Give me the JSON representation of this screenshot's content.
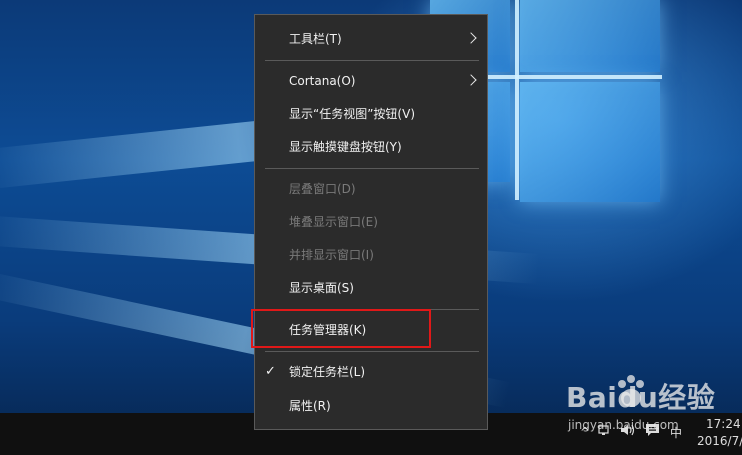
{
  "menu": {
    "items": [
      {
        "label": "工具栏(T)",
        "submenu": true,
        "enabled": true
      },
      {
        "label": "Cortana(O)",
        "submenu": true,
        "enabled": true
      },
      {
        "label": "显示“任务视图”按钮(V)",
        "enabled": true
      },
      {
        "label": "显示触摸键盘按钮(Y)",
        "enabled": true
      },
      {
        "label": "层叠窗口(D)",
        "enabled": false
      },
      {
        "label": "堆叠显示窗口(E)",
        "enabled": false
      },
      {
        "label": "并排显示窗口(I)",
        "enabled": false
      },
      {
        "label": "显示桌面(S)",
        "enabled": true
      },
      {
        "label": "任务管理器(K)",
        "enabled": true,
        "highlighted": true
      },
      {
        "label": "锁定任务栏(L)",
        "enabled": true,
        "checked": true
      },
      {
        "label": "属性(R)",
        "enabled": true
      }
    ],
    "check_mark": "✓"
  },
  "taskbar": {
    "tray_icons": [
      "chevron-up-icon",
      "network-icon",
      "volume-icon",
      "action-center-icon",
      "ime-icon"
    ],
    "ime_label": "中",
    "time": "17:24",
    "date": "2016/7/"
  },
  "watermark": {
    "brand": "Baidu经验",
    "url": "jingyan.baidu.com"
  },
  "colors": {
    "menu_bg": "#2b2b2b",
    "highlight_border": "#e01818",
    "taskbar_bg": "#101010"
  }
}
